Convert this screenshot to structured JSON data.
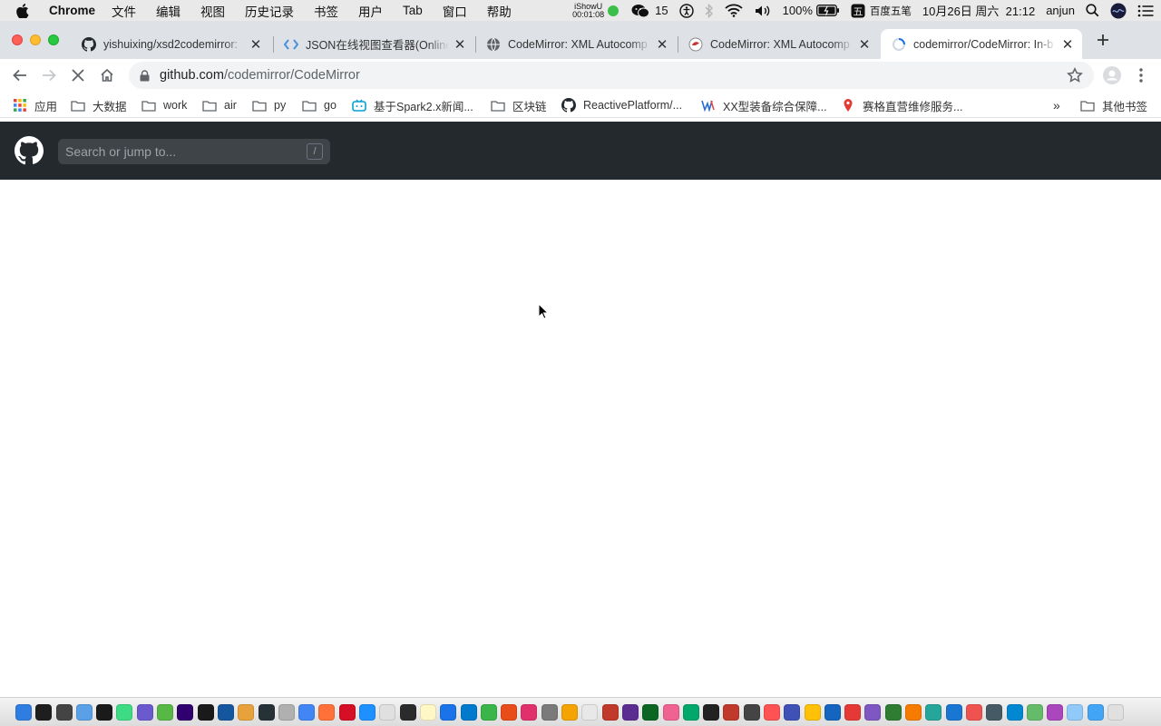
{
  "menubar": {
    "app_name": "Chrome",
    "menus": [
      "文件",
      "编辑",
      "视图",
      "历史记录",
      "书签",
      "用户",
      "Tab",
      "窗口",
      "帮助"
    ],
    "ishowu_name": "iShowU",
    "ishowu_time": "00:01:08",
    "wechat_count": "15",
    "battery": "100%",
    "input_method": "百度五笔",
    "datetime": "10月26日 周六  21:12",
    "user": "anjun"
  },
  "tabs": [
    {
      "title": "yishuixing/xsd2codemirror: ",
      "favicon": "github-icon",
      "active": false
    },
    {
      "title": "JSON在线视图查看器(Online",
      "favicon": "code-icon",
      "active": false
    },
    {
      "title": "CodeMirror: XML Autocomp",
      "favicon": "globe-icon",
      "active": false
    },
    {
      "title": "CodeMirror: XML Autocomp",
      "favicon": "codemirror-icon",
      "active": false
    },
    {
      "title": "codemirror/CodeMirror: In-b",
      "favicon": "loading-icon",
      "active": true
    }
  ],
  "omnibox": {
    "host": "github.com",
    "path": "/codemirror/CodeMirror"
  },
  "bookmarks": [
    {
      "label": "应用",
      "icon": "apps-grid-icon"
    },
    {
      "label": "大数据",
      "icon": "folder-icon"
    },
    {
      "label": "work",
      "icon": "folder-icon"
    },
    {
      "label": "air",
      "icon": "folder-icon"
    },
    {
      "label": "py",
      "icon": "folder-icon"
    },
    {
      "label": "go",
      "icon": "folder-icon"
    },
    {
      "label": "基于Spark2.x新闻...",
      "icon": "bilibili-icon"
    },
    {
      "label": "区块链",
      "icon": "folder-icon"
    },
    {
      "label": "ReactivePlatform/...",
      "icon": "github-icon"
    },
    {
      "label": "XX型装备综合保障...",
      "icon": "site-icon"
    },
    {
      "label": "赛格直营维修服务...",
      "icon": "pin-icon"
    }
  ],
  "bookmarks_overflow": "»",
  "other_bookmarks": "其他书签",
  "github": {
    "search_placeholder": "Search or jump to...",
    "search_shortcut": "/"
  },
  "colors": {
    "github_header": "#24292e",
    "tabstrip": "#dee1e6",
    "menubar": "#e9e9e9"
  },
  "dock_icon_colors": [
    "#2f7de1",
    "#1e1e1e",
    "#444",
    "#5aa0e6",
    "#1a1a1a",
    "#3ddc84",
    "#6a5acd",
    "#57b846",
    "#31006f",
    "#1a1a1a",
    "#15579e",
    "#e8a23c",
    "#263238",
    "#b0b0b0",
    "#4285f4",
    "#ff7139",
    "#d50f25",
    "#1e90ff",
    "#e0e0e0",
    "#2b2b2b",
    "#fff8c6",
    "#1a73e8",
    "#007acc",
    "#39b54a",
    "#e84c1b",
    "#e0316c",
    "#7a7a7a",
    "#f4a300",
    "#e8e8e8",
    "#c0392b",
    "#5c2d91",
    "#0b6623",
    "#f06292",
    "#00a86b",
    "#222",
    "#c0392b",
    "#444",
    "#ff5252",
    "#3f51b5",
    "#ffc107",
    "#1565c0",
    "#e53935",
    "#7e57c2",
    "#2e7d32",
    "#f57c00",
    "#26a69a",
    "#1976d2",
    "#ef5350",
    "#455a64",
    "#0288d1",
    "#66bb6a",
    "#ab47bc",
    "#90caf9",
    "#42a5f5",
    "#e0e0e0"
  ]
}
